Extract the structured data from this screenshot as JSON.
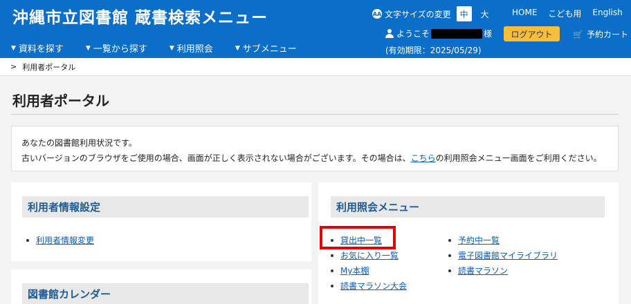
{
  "header": {
    "site_title": "沖縄市立図書館 蔵書検索メニュー",
    "nav": [
      "資料を探す",
      "一覧から探す",
      "利用照会",
      "サブメニュー"
    ],
    "font_size": {
      "label": "文字サイズの変更",
      "medium": "中",
      "large": "大"
    },
    "top_links": [
      "HOME",
      "こども用",
      "English"
    ],
    "welcome_prefix": "ようこそ",
    "welcome_suffix": "様",
    "expiry": "(有効期限：2025/05/29)",
    "logout_label": "ログアウト",
    "cart_label": "予約カート"
  },
  "breadcrumb": {
    "separator": ">",
    "current": "利用者ポータル"
  },
  "page": {
    "title": "利用者ポータル",
    "notice_line1": "あなたの図書館利用状況です。",
    "notice_line2_pre": "古いバージョンのブラウザをご使用の場合、画面が正しく表示されない場合がございます。その場合は、",
    "notice_link": "こちら",
    "notice_line2_post": "の利用照会メニュー画面をご利用ください。"
  },
  "panels": {
    "user_settings": {
      "title": "利用者情報設定",
      "links": [
        "利用者情報変更"
      ]
    },
    "inquiry": {
      "title": "利用照会メニュー",
      "left_links": [
        "貸出中一覧",
        "お気に入り一覧",
        "My本棚",
        "読書マラソン大会"
      ],
      "right_links": [
        "予約中一覧",
        "電子図書館マイライブラリ",
        "読書マラソン"
      ]
    },
    "calendar": {
      "title": "図書館カレンダー"
    }
  }
}
